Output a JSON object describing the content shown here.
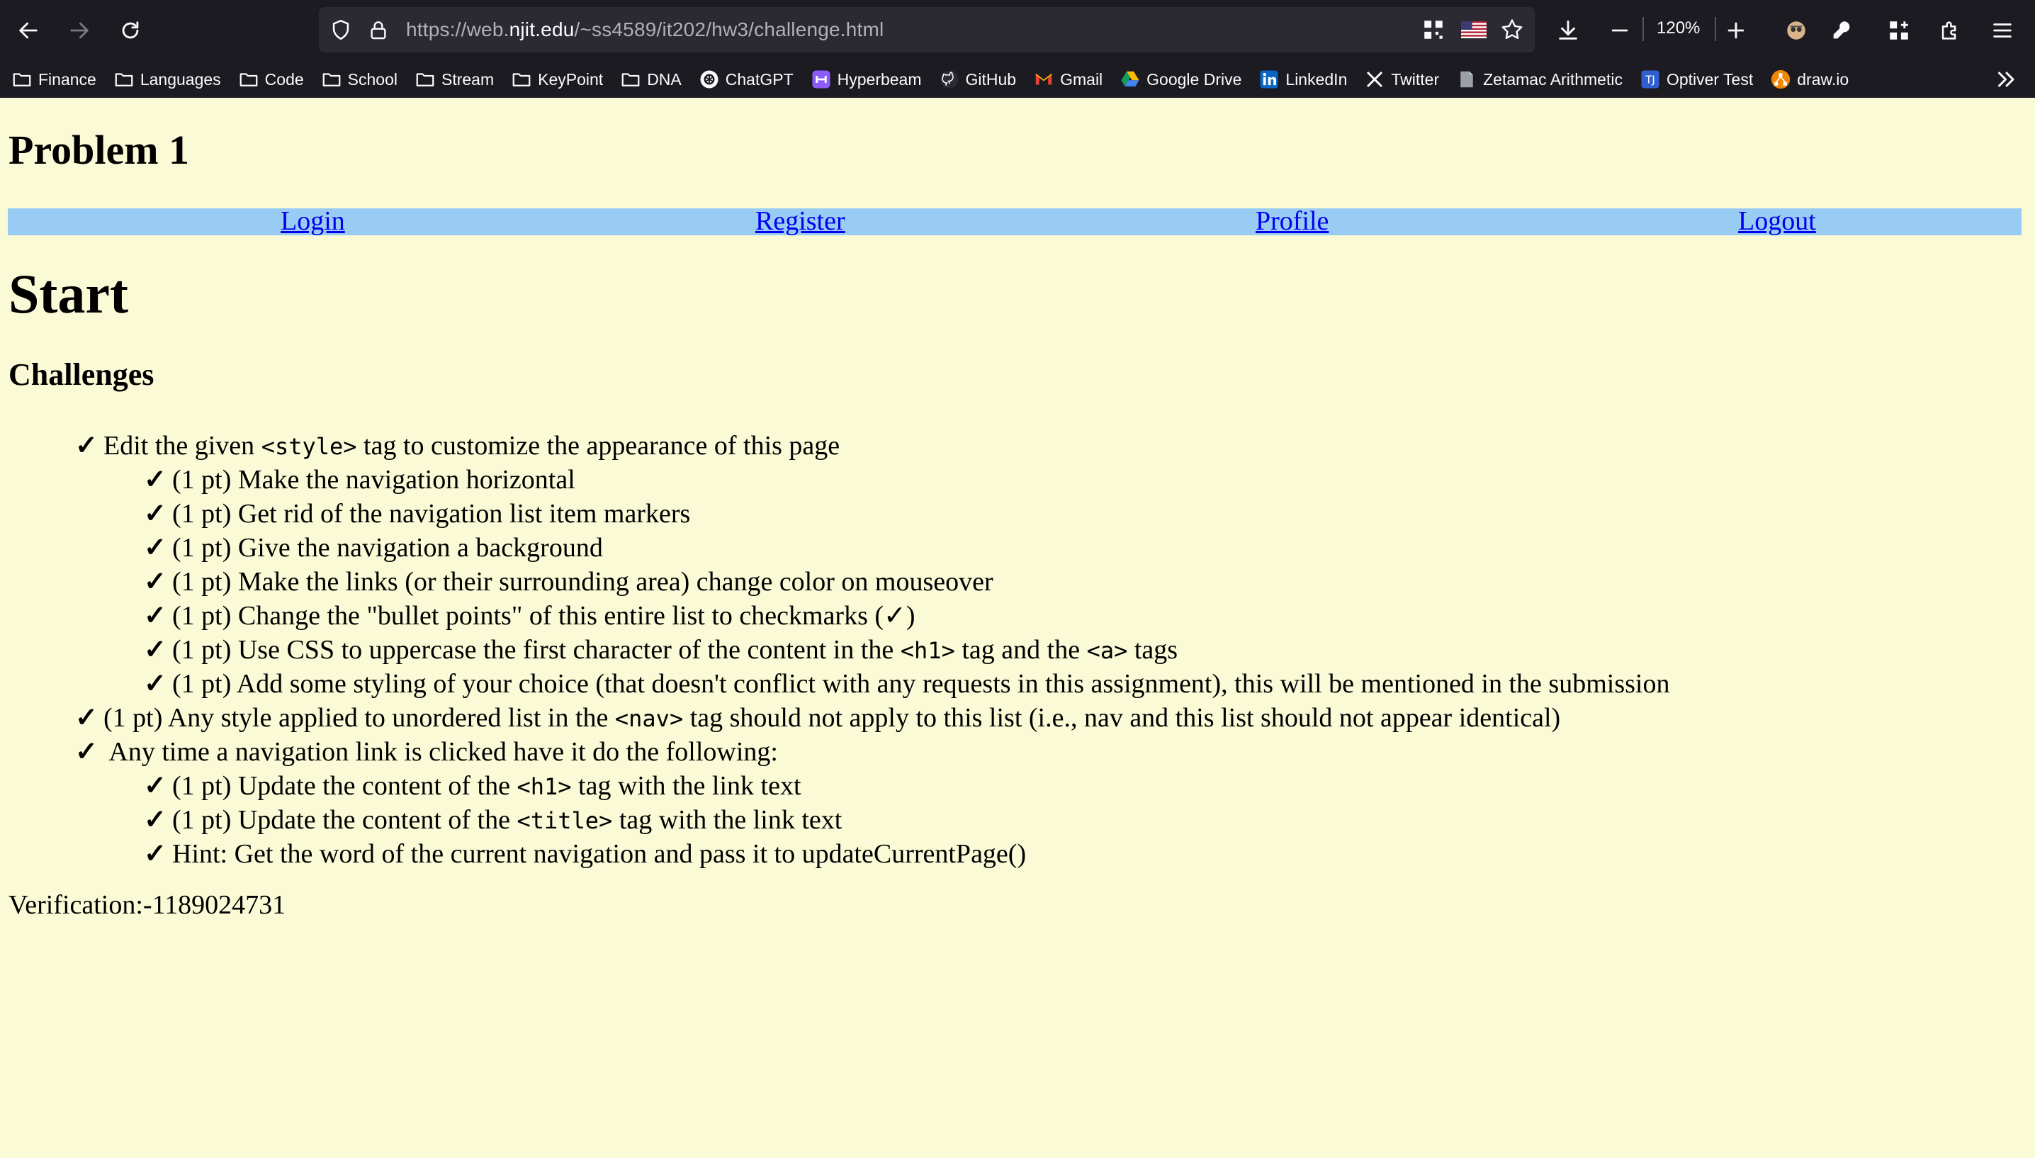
{
  "browser": {
    "url_prefix": "https://web.",
    "url_domain": "njit.edu",
    "url_path": "/~ss4589/it202/hw3/challenge.html",
    "zoom": "120%",
    "bookmarks": [
      {
        "label": "Finance",
        "icon": "folder-icon"
      },
      {
        "label": "Languages",
        "icon": "folder-icon"
      },
      {
        "label": "Code",
        "icon": "folder-icon"
      },
      {
        "label": "School",
        "icon": "folder-icon"
      },
      {
        "label": "Stream",
        "icon": "folder-icon"
      },
      {
        "label": "KeyPoint",
        "icon": "folder-icon"
      },
      {
        "label": "DNA",
        "icon": "folder-icon"
      },
      {
        "label": "ChatGPT",
        "icon": "chatgpt-icon"
      },
      {
        "label": "Hyperbeam",
        "icon": "hyperbeam-icon"
      },
      {
        "label": "GitHub",
        "icon": "github-icon"
      },
      {
        "label": "Gmail",
        "icon": "gmail-icon"
      },
      {
        "label": "Google Drive",
        "icon": "google-drive-icon"
      },
      {
        "label": "LinkedIn",
        "icon": "linkedin-icon"
      },
      {
        "label": "Twitter",
        "icon": "twitter-icon"
      },
      {
        "label": "Zetamac Arithmetic",
        "icon": "zetamac-icon"
      },
      {
        "label": "Optiver Test",
        "icon": "optiver-icon"
      },
      {
        "label": "draw.io",
        "icon": "drawio-icon"
      }
    ]
  },
  "page": {
    "problem_title": "Problem 1",
    "nav": [
      "Login",
      "Register",
      "Profile",
      "Logout"
    ],
    "heading": "Start",
    "challenges_title": "Challenges",
    "check": "✓",
    "items": [
      {
        "pre": "Edit the given ",
        "code": "<style>",
        "post": " tag to customize the appearance of this page"
      },
      {
        "pre": "(1 pt) Make the navigation horizontal",
        "code": "",
        "post": ""
      },
      {
        "pre": "(1 pt) Get rid of the navigation list item markers",
        "code": "",
        "post": ""
      },
      {
        "pre": "(1 pt) Give the navigation a background",
        "code": "",
        "post": ""
      },
      {
        "pre": "(1 pt) Make the links (or their surrounding area) change color on mouseover",
        "code": "",
        "post": ""
      },
      {
        "pre": "(1 pt) Change the \"bullet points\" of this entire list to checkmarks (✓)",
        "code": "",
        "post": ""
      },
      {
        "pre": "(1 pt) Use CSS to uppercase the first character of the content in the ",
        "code": "<h1>",
        "post": " tag and the ",
        "code2": "<a>",
        "post2": " tags"
      },
      {
        "pre": "(1 pt) Add some styling of your choice (that doesn't conflict with any requests in this assignment), this will be mentioned in the submission",
        "code": "",
        "post": ""
      },
      {
        "pre": "(1 pt) Any style applied to unordered list in the ",
        "code": "<nav>",
        "post": " tag should not apply to this list (i.e., nav and this list should not appear identical)"
      },
      {
        "pre": " Any time a navigation link is clicked have it do the following:",
        "code": "",
        "post": ""
      },
      {
        "pre": "(1 pt) Update the content of the ",
        "code": "<h1>",
        "post": " tag with the link text"
      },
      {
        "pre": "(1 pt) Update the content of the ",
        "code": "<title>",
        "post": " tag with the link text"
      },
      {
        "pre": "Hint: Get the word of the current navigation and pass it to updateCurrentPage()",
        "code": "",
        "post": ""
      }
    ],
    "verification": "Verification:-1189024731"
  }
}
